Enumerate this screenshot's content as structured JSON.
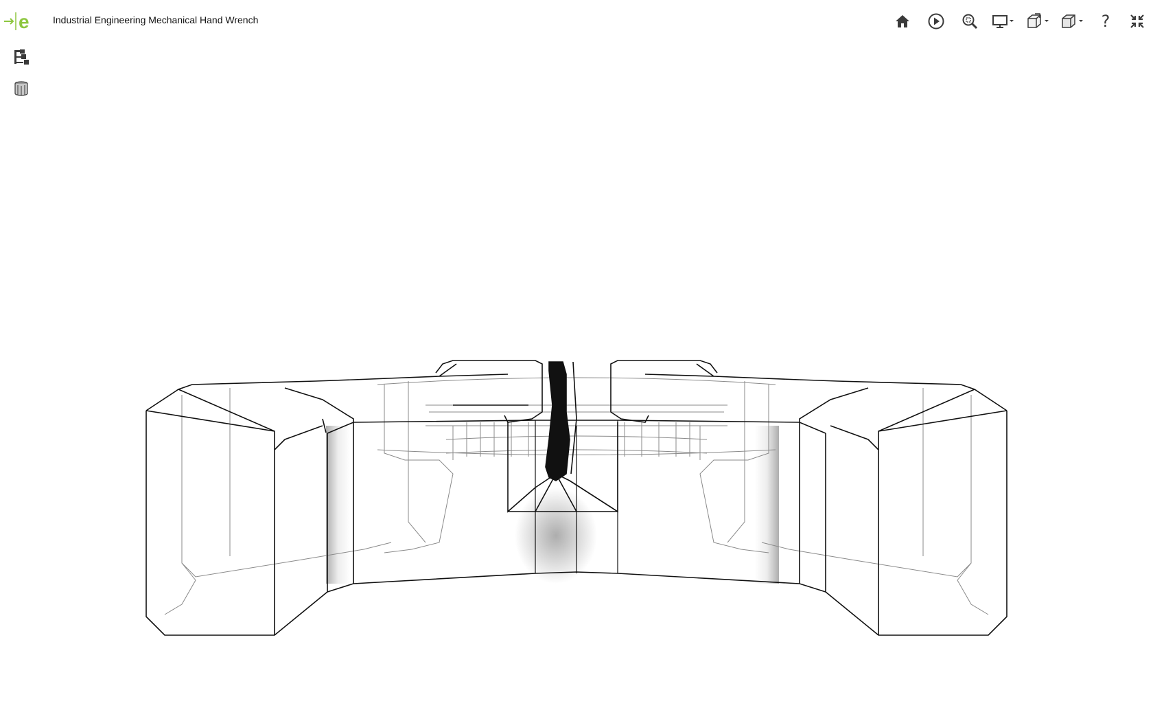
{
  "app": {
    "logo_icon": "e-arrow-logo-icon",
    "title": "Industrial Engineering Mechanical Hand Wrench",
    "brand_color": "#8dc63f"
  },
  "toolbar": {
    "items": [
      {
        "name": "home-button",
        "icon": "home-icon"
      },
      {
        "name": "play-button",
        "icon": "play-circle-icon"
      },
      {
        "name": "zoom-fit-button",
        "icon": "zoom-fit-icon"
      },
      {
        "name": "display-mode-dropdown",
        "icon": "monitor-icon"
      },
      {
        "name": "explode-dropdown",
        "icon": "explode-box-icon"
      },
      {
        "name": "view-orientation-dropdown",
        "icon": "cube-icon"
      },
      {
        "name": "help-button",
        "icon": "help-icon",
        "label": "?"
      },
      {
        "name": "fullscreen-exit-button",
        "icon": "collapse-arrows-icon"
      }
    ]
  },
  "sidebar": {
    "items": [
      {
        "name": "model-tree-button",
        "icon": "model-tree-icon"
      },
      {
        "name": "materials-button",
        "icon": "cylinder-stack-icon"
      }
    ]
  },
  "viewport": {
    "content": "wireframe-model",
    "render_style": "hidden-line with gray shading"
  }
}
